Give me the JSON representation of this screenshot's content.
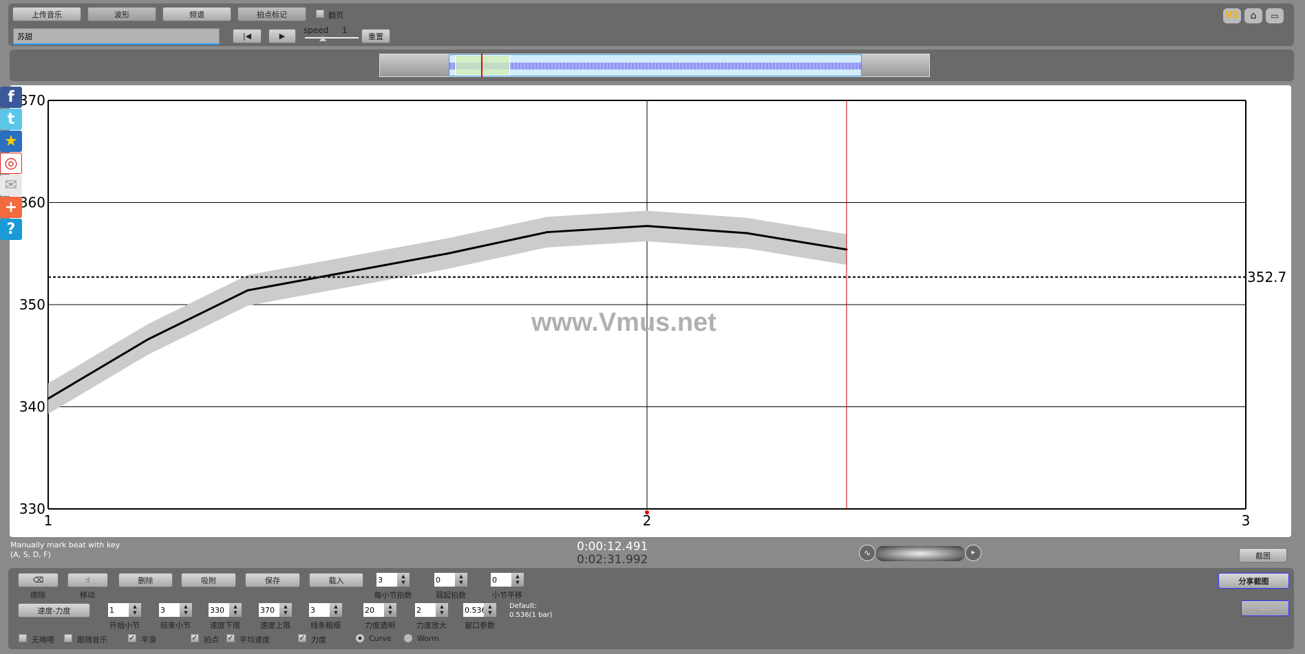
{
  "toolbar": {
    "upload": "上传音乐",
    "waveform": "波形",
    "spectrum": "频谱",
    "beat_mark": "拍点标记",
    "page_turn": "翻页",
    "song_name": "苏甜",
    "speed_label": "speed",
    "speed_value": "1",
    "reset": "重置"
  },
  "top_icons": [
    "v2-icon",
    "home-icon",
    "screen-icon"
  ],
  "v2_label": "V2",
  "overview": {
    "position_fraction": 0.19
  },
  "social": [
    "facebook-icon",
    "twitter-icon",
    "star-icon",
    "weibo-icon",
    "mail-icon",
    "plus-icon",
    "help-icon"
  ],
  "watermark": "www.Vmus.net",
  "chart_data": {
    "type": "line",
    "x": [
      1,
      1.1667,
      1.3333,
      1.5,
      1.6667,
      1.8333,
      2,
      2.1667,
      2.3333
    ],
    "y": [
      340.8,
      346.6,
      351.4,
      353.2,
      355.0,
      357.1,
      357.7,
      357.0,
      355.4
    ],
    "band": 1.5,
    "xlim": [
      1,
      3
    ],
    "ylim": [
      330,
      370
    ],
    "xticks": [
      "1",
      "2",
      "3"
    ],
    "yticks": [
      "330",
      "340",
      "350",
      "360",
      "370"
    ],
    "mean": 352.7,
    "mean_label": "352.7",
    "cursor_x": 2.3333,
    "grid": true,
    "colors": {
      "line": "#000000",
      "band": "#cccccc",
      "cursor": "#cc0000"
    }
  },
  "status": {
    "hint1": "Manually mark beat with key",
    "hint2": "(A, S, D, F)",
    "time_current": "0:00:12.491",
    "time_total": "0:02:31.992",
    "screenshot": "截图"
  },
  "controls": {
    "erase": "擦除",
    "move": "移动",
    "delete": "删除",
    "snap": "吸附",
    "save": "保存",
    "load": "载入",
    "beats_per_bar": {
      "label": "每小节拍数",
      "value": "3"
    },
    "pickup": {
      "label": "弱起拍数",
      "value": "0"
    },
    "bar_shift": {
      "label": "小节平移",
      "value": "0"
    },
    "tempo_dynamics": "速度-力度",
    "start_bar": {
      "label": "开始小节",
      "value": "1"
    },
    "end_bar": {
      "label": "结束小节",
      "value": "3"
    },
    "tempo_min": {
      "label": "速度下限",
      "value": "330"
    },
    "tempo_max": {
      "label": "速度上限",
      "value": "370"
    },
    "line_width": {
      "label": "线条粗细",
      "value": "3"
    },
    "dyn_alpha": {
      "label": "力度透明",
      "value": "20"
    },
    "dyn_scale": {
      "label": "力度放大",
      "value": "2"
    },
    "window": {
      "label": "窗口参数",
      "value": "0.536"
    },
    "default1": "Default:",
    "default2": "0.536(1 bar)",
    "no_click": "无嘀嗒",
    "follow": "跟随音乐",
    "smooth": "平滑",
    "beats": "拍点",
    "avg_tempo": "平均速度",
    "dynamics": "力度",
    "curve": "Curve",
    "worm": "Worm",
    "share": "分享截图",
    "ioi": "IOI"
  }
}
